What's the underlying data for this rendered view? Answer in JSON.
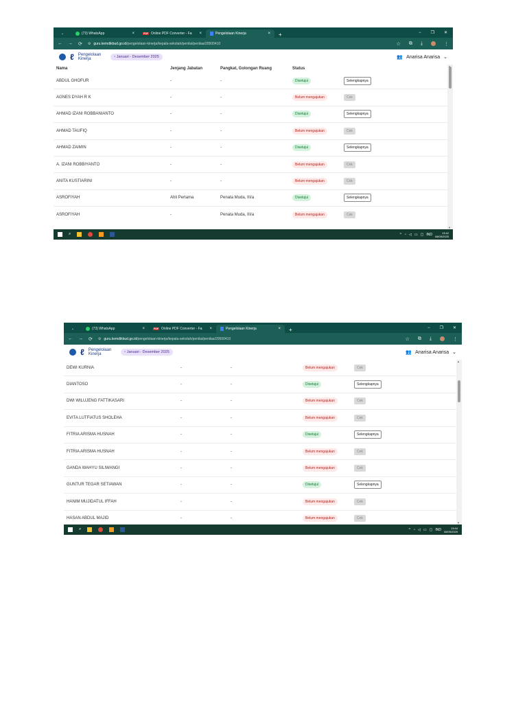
{
  "tabs": [
    {
      "label": "(73) WhatsApp"
    },
    {
      "label": "Online PDF Converter - Fast, ea"
    },
    {
      "label": "Pengelolaan Kinerja"
    }
  ],
  "url": {
    "host": "guru.kemdikbud.go.id",
    "path": "/pengelolaan-kinerja/kepala-sekolah/penilai/penilaa/20500410"
  },
  "app": {
    "brand_line1": "Pengelolaan",
    "brand_line2": "Kinerja",
    "period": "Januari - Desember 2025",
    "user": "Anarisa Anarisa"
  },
  "table": {
    "headers": {
      "nama": "Nama",
      "jenjang": "Jenjang Jabatan",
      "pangkat": "Pangkat, Golongan Ruang",
      "status": "Status"
    },
    "labels": {
      "approved": "Disetujui",
      "pending": "Belum mengajukan",
      "cek": "Cek",
      "more": "Selengkapnya"
    }
  },
  "screens": [
    {
      "show_header": true,
      "rows": [
        {
          "nama": "ABDUL GHOFUR",
          "jenjang": "-",
          "pangkat": "-",
          "approved": true
        },
        {
          "nama": "AGNES DYAH R K",
          "jenjang": "-",
          "pangkat": "-",
          "approved": false
        },
        {
          "nama": "AHMAD IZANI ROBBANIANTO",
          "jenjang": "-",
          "pangkat": "-",
          "approved": true
        },
        {
          "nama": "AHMAD TAUFIQ",
          "jenjang": "-",
          "pangkat": "-",
          "approved": false
        },
        {
          "nama": "AHMAD ZAIMIN",
          "jenjang": "-",
          "pangkat": "-",
          "approved": true
        },
        {
          "nama": "A. IZANI ROBBIYANTO",
          "jenjang": "-",
          "pangkat": "-",
          "approved": false
        },
        {
          "nama": "ANITA KUSTIARINI",
          "jenjang": "-",
          "pangkat": "-",
          "approved": false
        },
        {
          "nama": "ASROFIYAH",
          "jenjang": "Ahli Pertama",
          "pangkat": "Penata Muda, III/a",
          "approved": true
        },
        {
          "nama": "ASROFIYAH",
          "jenjang": "-",
          "pangkat": "Penata Muda, III/a",
          "approved": false
        }
      ],
      "clock_time": "13:42",
      "clock_date": "08/05/2025"
    },
    {
      "show_header": false,
      "rows": [
        {
          "nama": "DEWI KURNIA",
          "jenjang": "-",
          "pangkat": "-",
          "approved": false
        },
        {
          "nama": "DIANTOSO",
          "jenjang": "-",
          "pangkat": "-",
          "approved": true
        },
        {
          "nama": "DWI WILUJENG FATTIKASARI",
          "jenjang": "-",
          "pangkat": "-",
          "approved": false
        },
        {
          "nama": "EVITA LUTFIATUS SHOLEHA",
          "jenjang": "-",
          "pangkat": "-",
          "approved": false
        },
        {
          "nama": "FITRIA ARISMA HUSNAH",
          "jenjang": "-",
          "pangkat": "-",
          "approved": true
        },
        {
          "nama": "FITRIA ARISMA HUSNAH",
          "jenjang": "-",
          "pangkat": "-",
          "approved": false
        },
        {
          "nama": "GANDA WAHYU SILIWANGI",
          "jenjang": "-",
          "pangkat": "-",
          "approved": false
        },
        {
          "nama": "GUNTUR TEGAR SETIAWAN",
          "jenjang": "-",
          "pangkat": "-",
          "approved": true
        },
        {
          "nama": "HANIM MUJIDATUL IFFAH",
          "jenjang": "-",
          "pangkat": "-",
          "approved": false
        },
        {
          "nama": "HASAN ABDUL MAJID",
          "jenjang": "-",
          "pangkat": "-",
          "approved": false
        }
      ],
      "clock_time": "13:44",
      "clock_date": "08/05/2025"
    }
  ],
  "taskbar": {
    "lang": "IND"
  },
  "colors": {
    "tabbar": "#0e4d45",
    "urlbar": "#1c5f56",
    "approved_bg": "#d3f1dc",
    "pending_bg": "#fde7e7",
    "period_bg": "#e9e1fa"
  }
}
